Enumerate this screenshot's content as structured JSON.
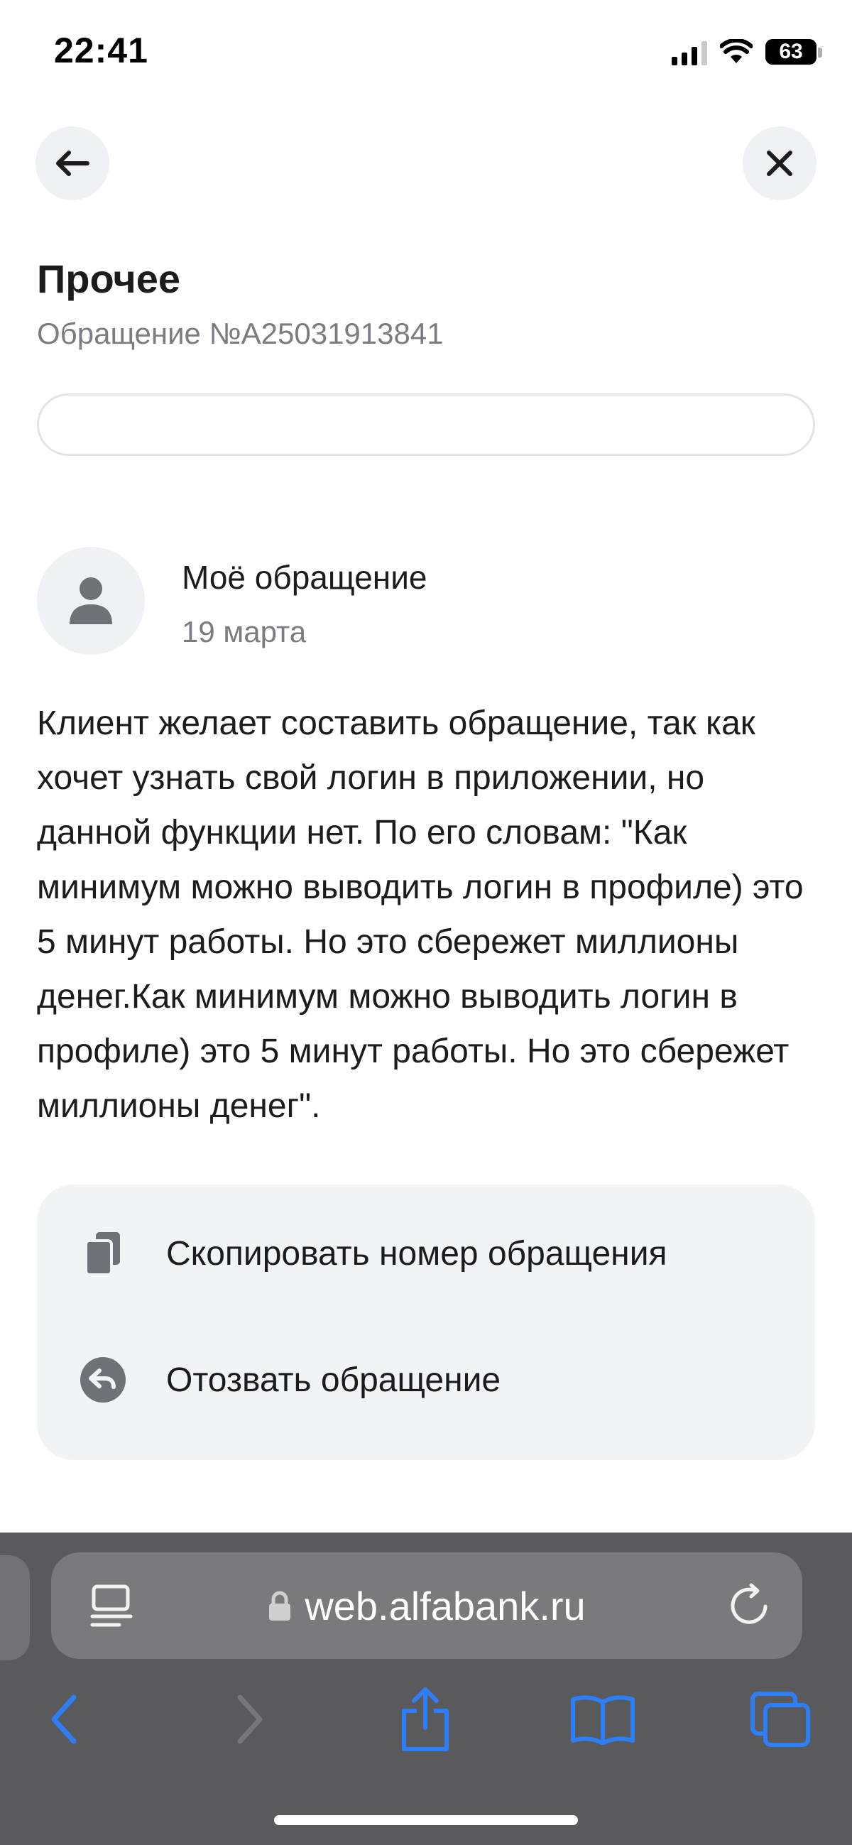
{
  "status_bar": {
    "time": "22:41",
    "battery": "63",
    "icons": [
      "signal-icon",
      "wifi-icon",
      "battery-icon"
    ]
  },
  "nav": {
    "back_icon": "arrow-left-icon",
    "close_icon": "close-icon"
  },
  "header": {
    "title": "Прочее",
    "subtitle": "Обращение №A25031913841"
  },
  "request": {
    "author_icon": "user-icon",
    "title": "Моё обращение",
    "date": "19 марта",
    "text": "Клиент желает составить обращение, так как хочет узнать свой логин в приложении, но данной функции нет. По его словам: \"Как минимум можно выводить логин в профиле) это 5 минут работы. Но это сбережет миллионы денег.Как минимум можно выводить логин в профиле) это 5 минут работы. Но это сбережет миллионы денег\"."
  },
  "actions": {
    "copy_label": "Скопировать номер обращения",
    "copy_icon": "copy-icon",
    "revoke_label": "Отозвать обращение",
    "revoke_icon": "revoke-arrow-icon"
  },
  "browser": {
    "url": "web.alfabank.ru",
    "colors": {
      "toolbar_bg": "#5a5a5c",
      "url_bar_bg": "#7a7a7c",
      "accent": "#2d7ff9",
      "disabled": "#76777b"
    },
    "toolbar_icons": [
      "back-arrow-icon",
      "forward-arrow-icon",
      "share-icon",
      "bookmarks-icon",
      "tabs-icon"
    ]
  }
}
